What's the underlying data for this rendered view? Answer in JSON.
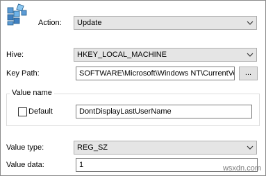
{
  "form": {
    "action": {
      "label": "Action:",
      "value": "Update"
    },
    "hive": {
      "label": "Hive:",
      "value": "HKEY_LOCAL_MACHINE"
    },
    "key_path": {
      "label": "Key Path:",
      "value": "SOFTWARE\\Microsoft\\Windows NT\\CurrentVersion\\Winlogon",
      "browse_label": "..."
    },
    "value_name": {
      "group_label": "Value name",
      "default_label": "Default",
      "default_checked": false,
      "value": "DontDisplayLastUserName"
    },
    "value_type": {
      "label": "Value type:",
      "value": "REG_SZ"
    },
    "value_data": {
      "label": "Value data:",
      "value": "1"
    }
  },
  "watermark": "wsxdn.com",
  "colors": {
    "combo_bg": "#e5e5e5",
    "border": "#adadad",
    "field_border": "#7a7a7a"
  },
  "icons": [
    "registry-cubes-icon",
    "chevron-down-icon"
  ]
}
